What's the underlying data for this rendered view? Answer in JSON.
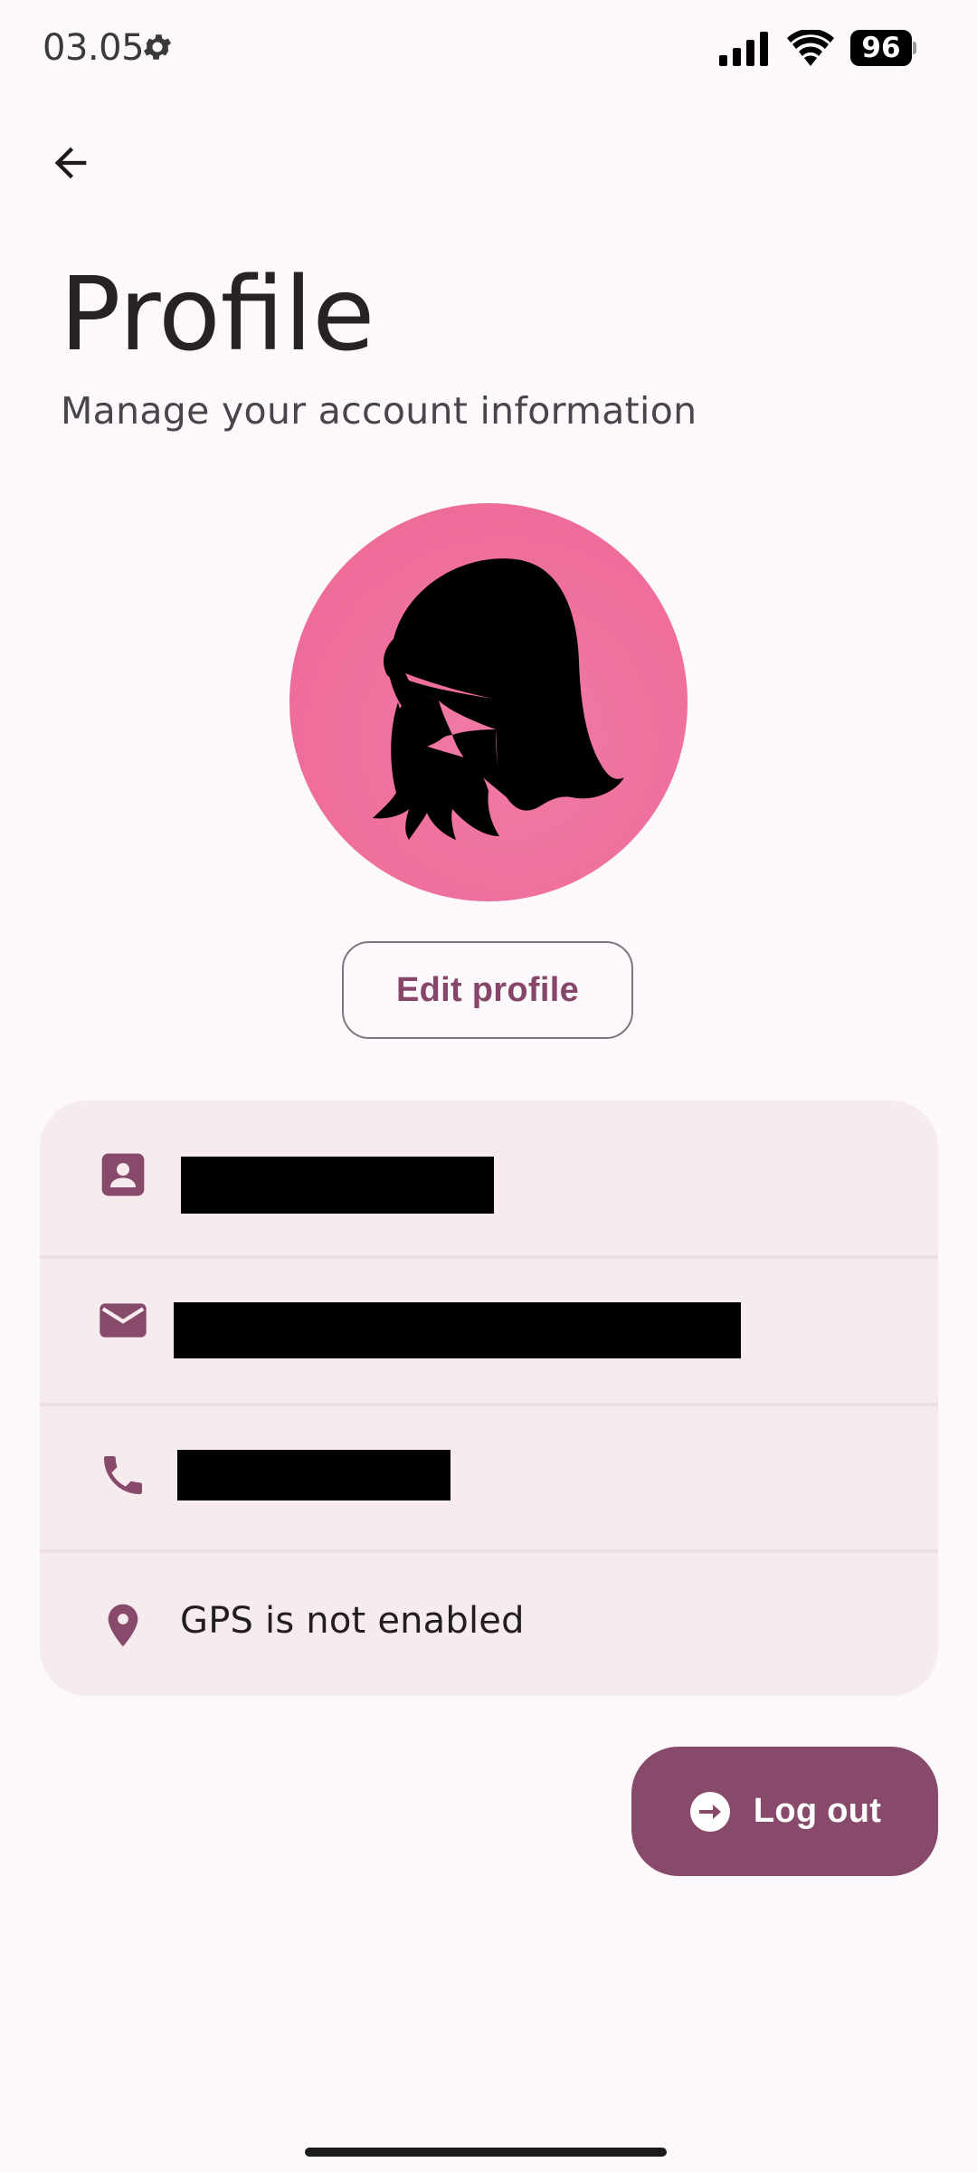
{
  "status_bar": {
    "time": "03.05",
    "battery_level": "96",
    "settings_icon": "gear-icon",
    "signal_icon": "signal-icon",
    "wifi_icon": "wifi-icon"
  },
  "header": {
    "back_icon": "arrow-left-icon",
    "title": "Profile",
    "subtitle": "Manage your account information"
  },
  "profile": {
    "avatar_icon": "woman-silhouette-avatar",
    "edit_label": "Edit profile"
  },
  "info": {
    "rows": [
      {
        "icon": "contact-card-icon",
        "value": "",
        "redacted": true
      },
      {
        "icon": "mail-icon",
        "value": "",
        "redacted": true
      },
      {
        "icon": "phone-icon",
        "value": "",
        "redacted": true
      },
      {
        "icon": "location-pin-icon",
        "value": "GPS is not enabled",
        "redacted": false
      }
    ]
  },
  "actions": {
    "logout_label": "Log out",
    "logout_icon": "logout-arrow-icon"
  },
  "colors": {
    "accent": "#884a6a",
    "avatar_bg": "#ef6e9c",
    "card_bg": "#f6ecee",
    "page_bg": "#fdf8fb"
  }
}
